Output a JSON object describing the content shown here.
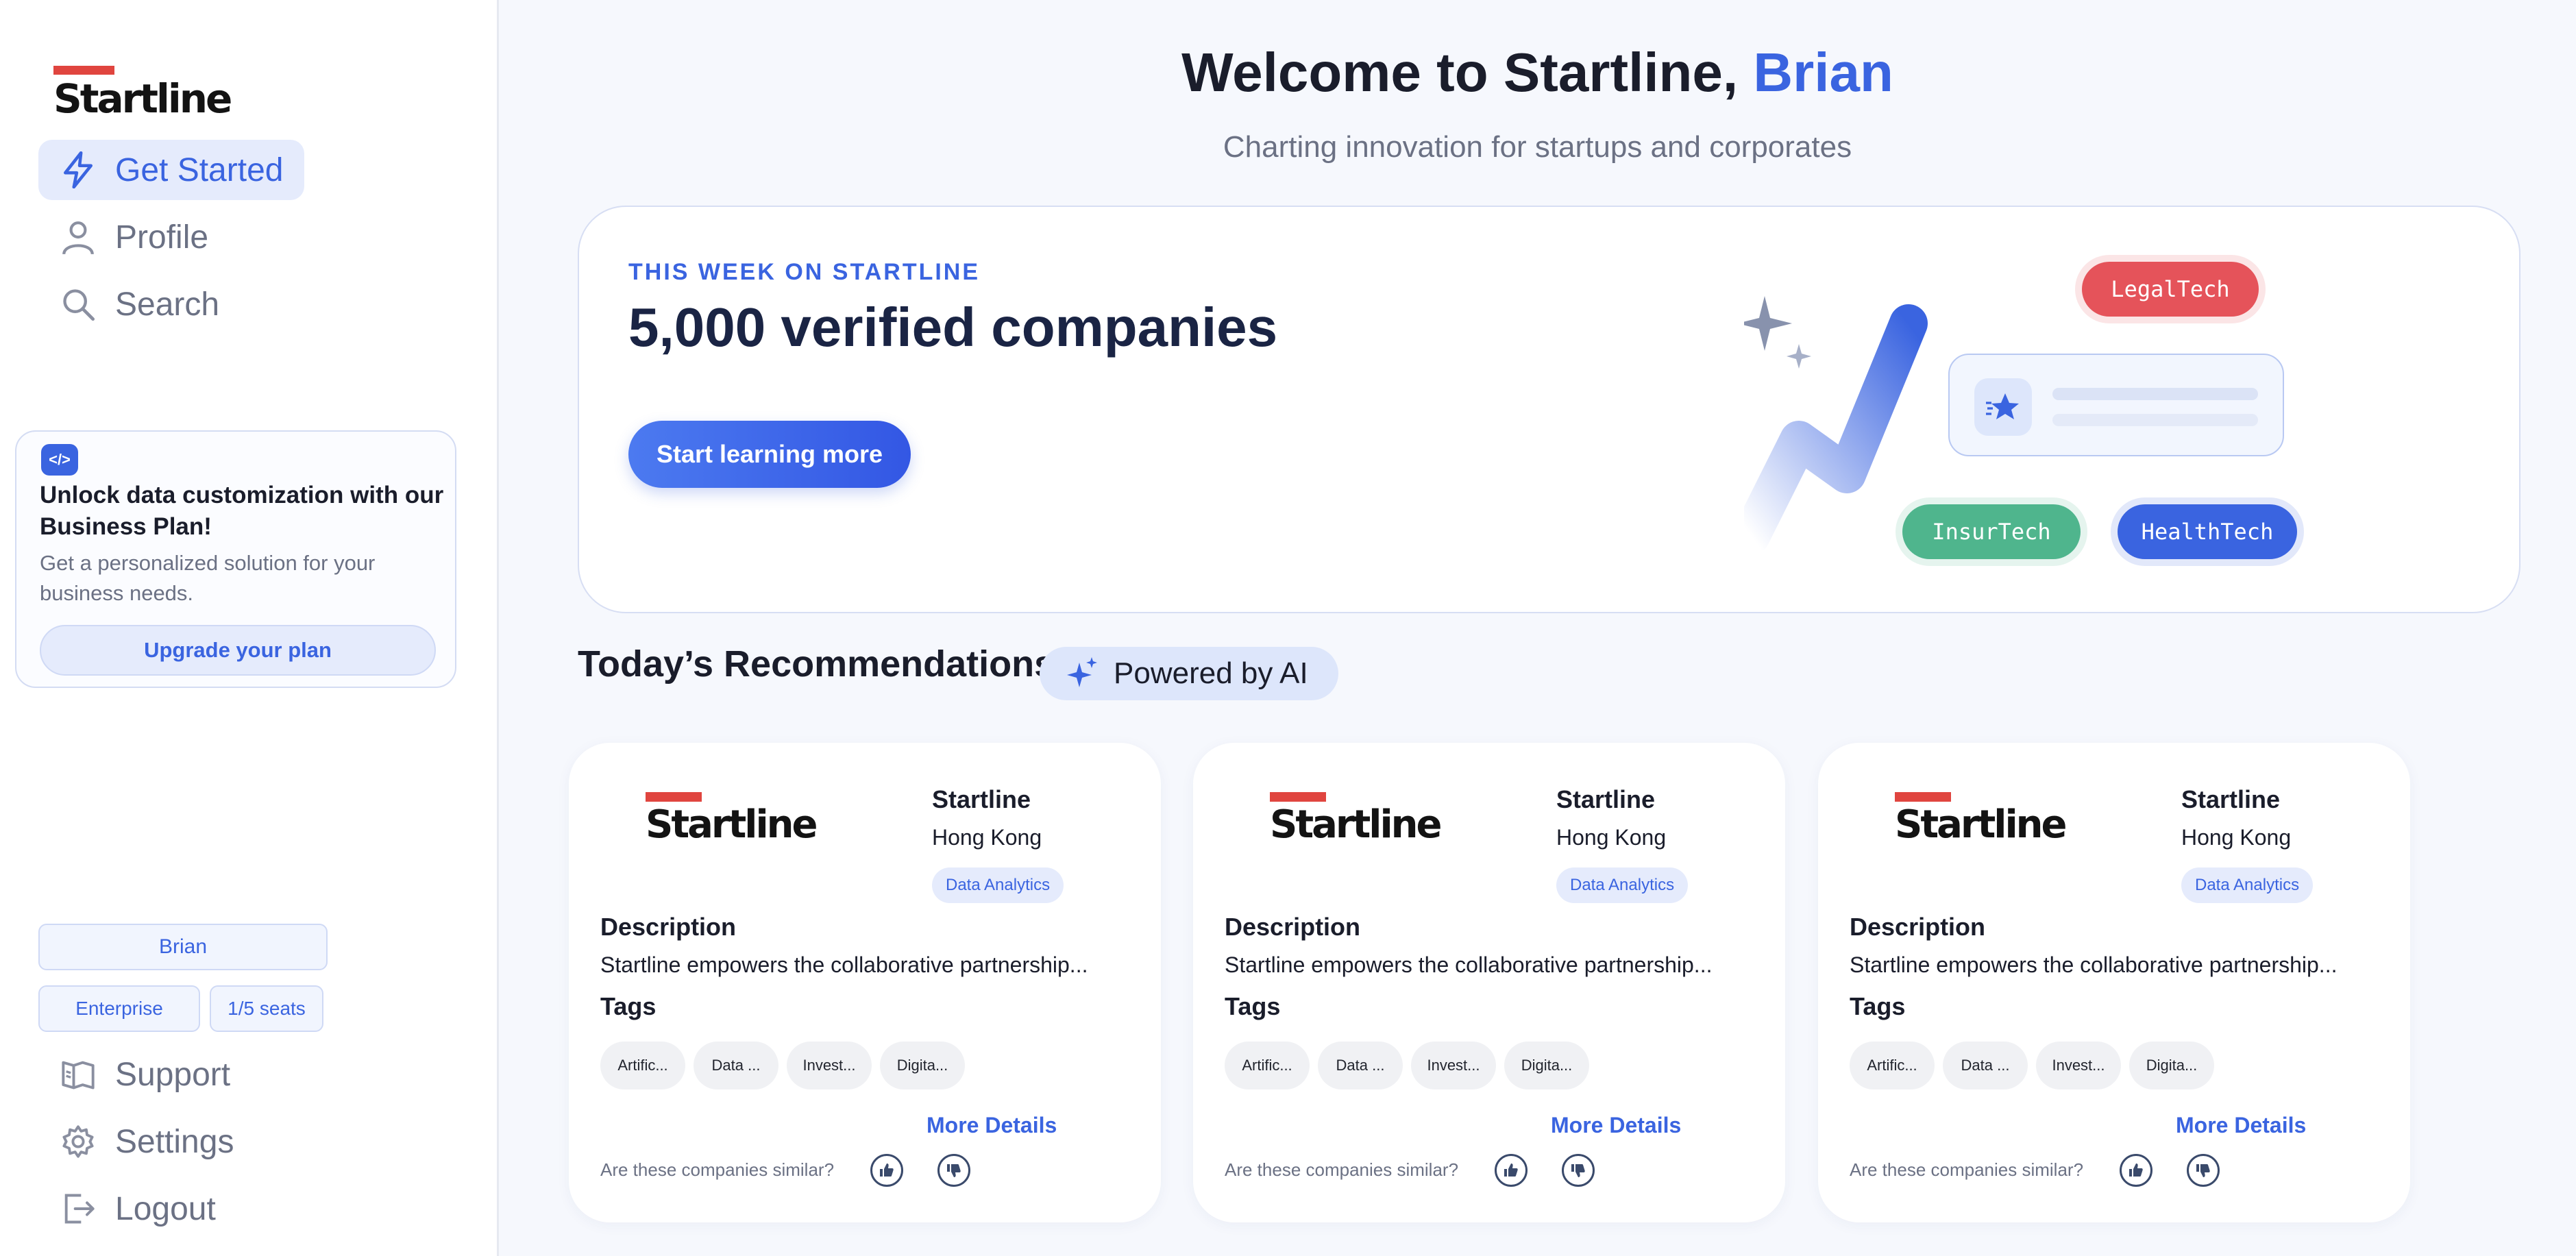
{
  "sidebar": {
    "logo_text": "Startline",
    "nav": [
      {
        "label": "Get Started",
        "icon": "lightning-icon",
        "active": true
      },
      {
        "label": "Profile",
        "icon": "user-icon"
      },
      {
        "label": "Search",
        "icon": "search-icon"
      }
    ],
    "promo": {
      "title": "Unlock data customization with our Business Plan!",
      "body": "Get a personalized solution for your business needs.",
      "button": "Upgrade your plan"
    },
    "user": {
      "name": "Brian",
      "plan": "Enterprise",
      "seats": "1/5 seats"
    },
    "bottom_nav": [
      {
        "label": "Support",
        "icon": "book-icon"
      },
      {
        "label": "Settings",
        "icon": "gear-icon"
      },
      {
        "label": "Logout",
        "icon": "logout-icon"
      }
    ]
  },
  "header": {
    "welcome_prefix": "Welcome to Startline,",
    "user_name": "Brian",
    "subtitle": "Charting innovation for startups and corporates"
  },
  "hero": {
    "eyebrow": "THIS WEEK ON STARTLINE",
    "headline": "5,000 verified companies",
    "cta": "Start learning more",
    "pills": [
      {
        "label": "LegalTech",
        "color": "#e5535a"
      },
      {
        "label": "InsurTech",
        "color": "#4fb58d"
      },
      {
        "label": "HealthTech",
        "color": "#3a64e0"
      }
    ]
  },
  "recommendations": {
    "title": "Today’s Recommendations",
    "badge": "Powered by AI",
    "cards": [
      {
        "logo_text": "Startline",
        "name": "Startline",
        "city": "Hong Kong",
        "industry": "Data Analytics",
        "description_label": "Description",
        "description": "Startline empowers the collaborative partnership...",
        "tags_label": "Tags",
        "tags": [
          "Artific...",
          "Data ...",
          "Invest...",
          "Digita..."
        ],
        "more": "More Details",
        "similar_prompt": "Are these companies similar?"
      },
      {
        "logo_text": "Startline",
        "name": "Startline",
        "city": "Hong Kong",
        "industry": "Data Analytics",
        "description_label": "Description",
        "description": "Startline empowers the collaborative partnership...",
        "tags_label": "Tags",
        "tags": [
          "Artific...",
          "Data ...",
          "Invest...",
          "Digita..."
        ],
        "more": "More Details",
        "similar_prompt": "Are these companies similar?"
      },
      {
        "logo_text": "Startline",
        "name": "Startline",
        "city": "Hong Kong",
        "industry": "Data Analytics",
        "description_label": "Description",
        "description": "Startline empowers the collaborative partnership...",
        "tags_label": "Tags",
        "tags": [
          "Artific...",
          "Data ...",
          "Invest...",
          "Digita..."
        ],
        "more": "More Details",
        "similar_prompt": "Are these companies similar?"
      }
    ]
  },
  "colors": {
    "accent": "#3a64e0",
    "brand_red": "#e0453f",
    "text_dark": "#1a1d2b",
    "text_muted": "#6b7184"
  }
}
